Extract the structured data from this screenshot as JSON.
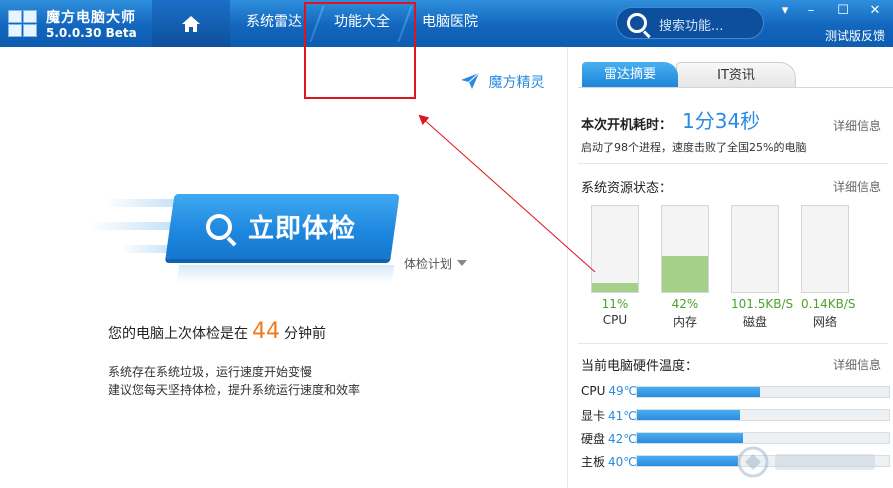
{
  "app": {
    "name": "魔方电脑大师",
    "version": "5.0.0.30 Beta"
  },
  "nav": {
    "tabs": [
      {
        "label": "系统雷达"
      },
      {
        "label": "功能大全"
      },
      {
        "label": "电脑医院"
      }
    ]
  },
  "search": {
    "placeholder": "搜索功能..."
  },
  "window": {
    "feedback": "测试版反馈"
  },
  "left": {
    "magic_elf": "魔方精灵",
    "check_button": "立即体检",
    "plan": "体检计划",
    "last_check_prefix": "您的电脑上次体检是在",
    "last_check_minutes": "44",
    "last_check_suffix": "分钟前",
    "hint_1": "系统存在系统垃圾，运行速度开始变慢",
    "hint_2": "建议您每天坚持体检，提升系统运行速度和效率"
  },
  "right": {
    "tabs": [
      {
        "label": "雷达摘要"
      },
      {
        "label": "IT资讯"
      }
    ],
    "detail_label": "详细信息",
    "boot": {
      "title": "本次开机耗时：",
      "time": "1分34秒",
      "desc": "启动了98个进程，速度击败了全国25%的电脑"
    },
    "resources": {
      "title": "系统资源状态：",
      "items": [
        {
          "name": "CPU",
          "value": "11%",
          "level": 0.11
        },
        {
          "name": "内存",
          "value": "42%",
          "level": 0.42
        },
        {
          "name": "磁盘",
          "value": "101.5KB/S",
          "level": 0
        },
        {
          "name": "网络",
          "value": "0.14KB/S",
          "level": 0
        }
      ]
    },
    "temps": {
      "title": "当前电脑硬件温度：",
      "items": [
        {
          "name": "CPU",
          "value": "49℃",
          "level": 0.49
        },
        {
          "name": "显卡",
          "value": "41℃",
          "level": 0.41
        },
        {
          "name": "硬盘",
          "value": "42℃",
          "level": 0.42
        },
        {
          "name": "主板",
          "value": "40℃",
          "level": 0.4
        }
      ]
    }
  },
  "colors": {
    "accent": "#2a8be0",
    "topbar": "#1266bd",
    "highlight_box": "#e0141e",
    "resource_fill": "#a5d08a",
    "orange": "#f07a1e"
  }
}
